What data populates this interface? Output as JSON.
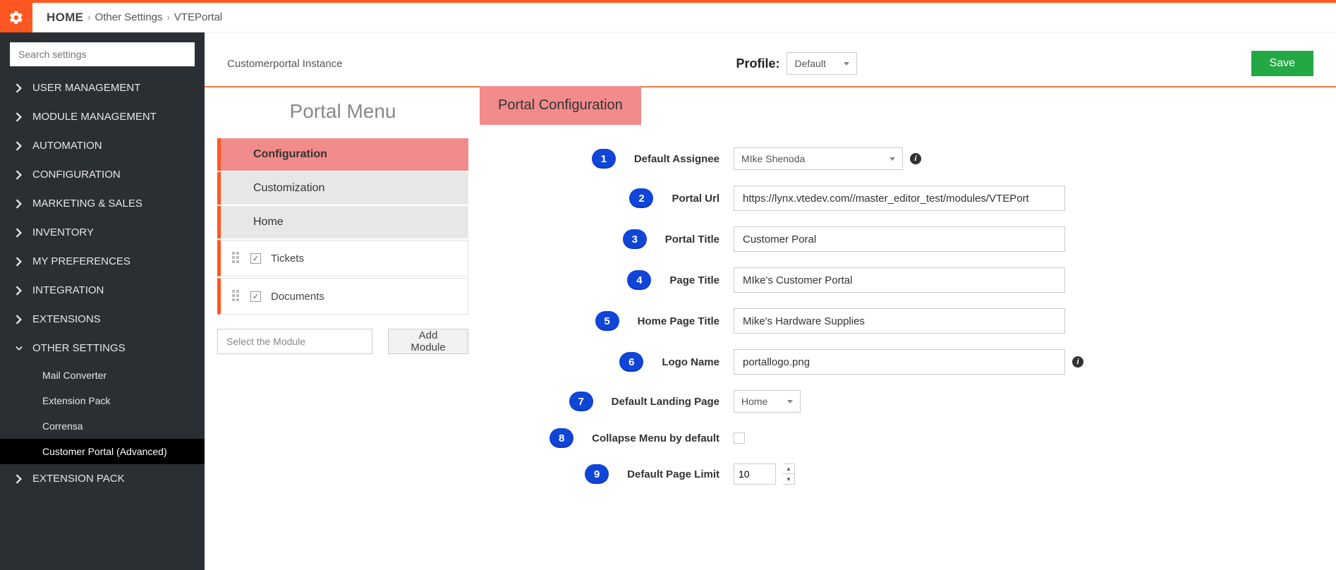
{
  "breadcrumb": {
    "home": "HOME",
    "level1": "Other Settings",
    "level2": "VTEPortal"
  },
  "sidebar": {
    "search_placeholder": "Search settings",
    "items": [
      {
        "label": "USER MANAGEMENT"
      },
      {
        "label": "MODULE MANAGEMENT"
      },
      {
        "label": "AUTOMATION"
      },
      {
        "label": "CONFIGURATION"
      },
      {
        "label": "MARKETING & SALES"
      },
      {
        "label": "INVENTORY"
      },
      {
        "label": "MY PREFERENCES"
      },
      {
        "label": "INTEGRATION"
      },
      {
        "label": "EXTENSIONS"
      },
      {
        "label": "OTHER SETTINGS",
        "open": true
      },
      {
        "label": "EXTENSION PACK"
      }
    ],
    "other_settings_children": [
      {
        "label": "Mail Converter"
      },
      {
        "label": "Extension Pack"
      },
      {
        "label": "Corrensa"
      },
      {
        "label": "Customer Portal (Advanced)",
        "active": true
      }
    ]
  },
  "toolbar": {
    "instance": "Customerportal Instance",
    "profile_label": "Profile:",
    "profile_value": "Default",
    "save": "Save"
  },
  "portal_menu": {
    "title": "Portal Menu",
    "items": [
      {
        "label": "Configuration",
        "active": true
      },
      {
        "label": "Customization"
      },
      {
        "label": "Home"
      }
    ],
    "sub_items": [
      {
        "label": "Tickets",
        "checked": true
      },
      {
        "label": "Documents",
        "checked": true
      }
    ],
    "select_placeholder": "Select the Module",
    "add_button": "Add Module"
  },
  "config": {
    "tab": "Portal Configuration",
    "fields": {
      "f1": {
        "n": "1",
        "label": "Default Assignee",
        "value": "MIke Shenoda",
        "type": "select",
        "info": true
      },
      "f2": {
        "n": "2",
        "label": "Portal Url",
        "value": "https://lynx.vtedev.com//master_editor_test/modules/VTEPort",
        "type": "text"
      },
      "f3": {
        "n": "3",
        "label": "Portal Title",
        "value": "Customer Poral",
        "type": "text"
      },
      "f4": {
        "n": "4",
        "label": "Page Title",
        "value": "MIke's Customer Portal",
        "type": "text"
      },
      "f5": {
        "n": "5",
        "label": "Home Page Title",
        "value": "Mike's Hardware Supplies",
        "type": "text"
      },
      "f6": {
        "n": "6",
        "label": "Logo Name",
        "value": "portallogo.png",
        "type": "text",
        "info": true
      },
      "f7": {
        "n": "7",
        "label": "Default Landing Page",
        "value": "Home",
        "type": "select-small"
      },
      "f8": {
        "n": "8",
        "label": "Collapse Menu by default",
        "value": "",
        "type": "checkbox"
      },
      "f9": {
        "n": "9",
        "label": "Default Page Limit",
        "value": "10",
        "type": "number"
      }
    }
  }
}
